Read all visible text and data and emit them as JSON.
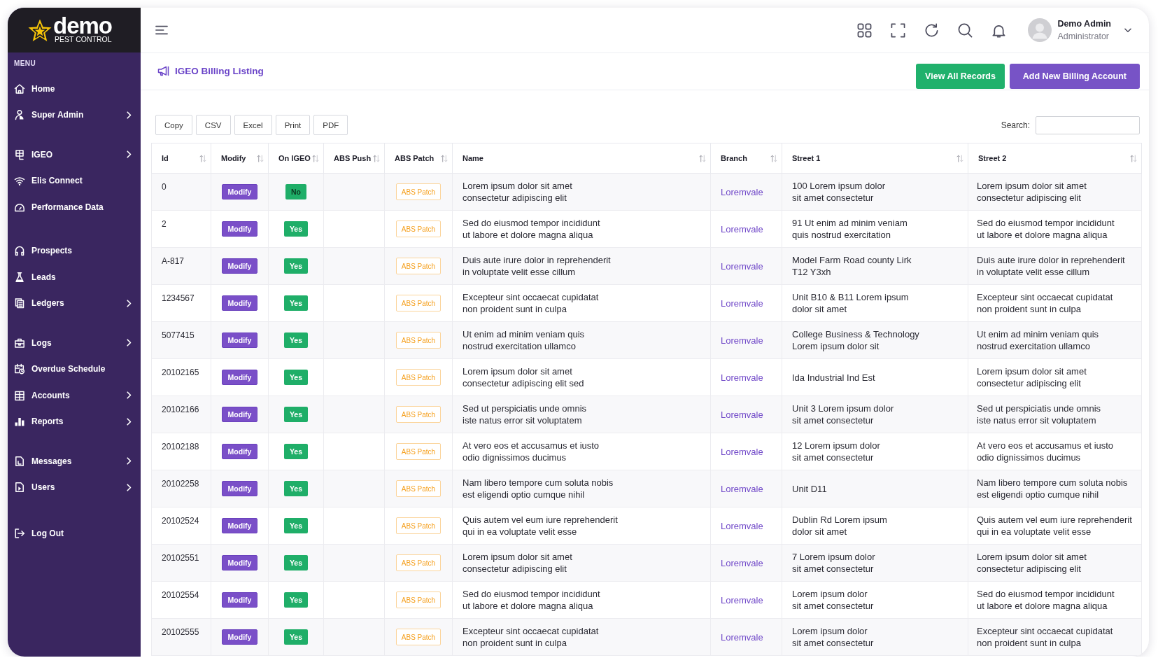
{
  "brand": {
    "name": "demo",
    "tagline": "PEST CONTROL"
  },
  "sidebar": {
    "heading": "MENU",
    "groups": [
      {
        "items": [
          {
            "label": "Home",
            "expandable": false
          },
          {
            "label": "Super Admin",
            "expandable": true
          }
        ]
      },
      {
        "items": [
          {
            "label": "IGEO",
            "expandable": true
          },
          {
            "label": "Elis Connect",
            "expandable": false
          },
          {
            "label": "Performance Data",
            "expandable": false
          }
        ]
      },
      {
        "items": [
          {
            "label": "Prospects",
            "expandable": false
          },
          {
            "label": "Leads",
            "expandable": false
          },
          {
            "label": "Ledgers",
            "expandable": true
          }
        ]
      },
      {
        "items": [
          {
            "label": "Logs",
            "expandable": true
          },
          {
            "label": "Overdue Schedule",
            "expandable": false
          },
          {
            "label": "Accounts",
            "expandable": true
          },
          {
            "label": "Reports",
            "expandable": true
          }
        ]
      },
      {
        "items": [
          {
            "label": "Messages",
            "expandable": true
          },
          {
            "label": "Users",
            "expandable": true
          }
        ]
      },
      {
        "items": [
          {
            "label": "Log Out",
            "expandable": false
          }
        ]
      }
    ]
  },
  "header": {
    "user": {
      "name": "Demo Admin",
      "role": "Administrator"
    }
  },
  "page": {
    "title": "IGEO Billing Listing",
    "actions": [
      {
        "label": "View All Records",
        "kind": "success"
      },
      {
        "label": "Add New Billing Account",
        "kind": "primary"
      }
    ]
  },
  "export_buttons": [
    "Copy",
    "CSV",
    "Excel",
    "Print",
    "PDF"
  ],
  "search": {
    "label": "Search:"
  },
  "table": {
    "columns": [
      "Id",
      "Modify",
      "On IGEO",
      "ABS Push",
      "ABS Patch",
      "Name",
      "Branch",
      "Street 1",
      "Street 2"
    ],
    "rows": [
      {
        "id": "0",
        "modify": "Modify",
        "on_igeo": {
          "label": "No",
          "muted": true
        },
        "abs_patch": "ABS Patch",
        "name": "Lorem ipsum dolor sit amet\nconsectetur adipiscing elit",
        "branch": "Loremvale",
        "street_1": "100 Lorem ipsum dolor\nsit amet consectetur",
        "street_2": "Lorem ipsum dolor sit amet\nconsectetur adipiscing elit"
      },
      {
        "id": "2",
        "modify": "Modify",
        "on_igeo": {
          "label": "Yes",
          "muted": false
        },
        "abs_patch": "ABS Patch",
        "name": "Sed do eiusmod tempor incididunt\nut labore et dolore magna aliqua",
        "branch": "Loremvale",
        "street_1": "91 Ut enim ad minim veniam\nquis nostrud exercitation",
        "street_2": "Sed do eiusmod tempor incididunt\nut labore et dolore magna aliqua"
      },
      {
        "id": "A-817",
        "modify": "Modify",
        "on_igeo": {
          "label": "Yes",
          "muted": false
        },
        "abs_patch": "ABS Patch",
        "name": "Duis aute irure dolor in reprehenderit\nin voluptate velit esse cillum",
        "branch": "Loremvale",
        "street_1": "Model Farm Road county Lirk\nT12 Y3xh",
        "street_2": "Duis aute irure dolor in reprehenderit\nin voluptate velit esse cillum"
      },
      {
        "id": "1234567",
        "modify": "Modify",
        "on_igeo": {
          "label": "Yes",
          "muted": false
        },
        "abs_patch": "ABS Patch",
        "name": "Excepteur sint occaecat cupidatat\nnon proident sunt in culpa",
        "branch": "Loremvale",
        "street_1": "Unit B10 & B11 Lorem ipsum\ndolor sit amet",
        "street_2": "Excepteur sint occaecat cupidatat\nnon proident sunt in culpa"
      },
      {
        "id": "5077415",
        "modify": "Modify",
        "on_igeo": {
          "label": "Yes",
          "muted": false
        },
        "abs_patch": "ABS Patch",
        "name": "Ut enim ad minim veniam quis\nnostrud exercitation ullamco",
        "branch": "Loremvale",
        "street_1": "College Business & Technology\nLorem ipsum dolor sit",
        "street_2": "Ut enim ad minim veniam quis\nnostrud exercitation ullamco"
      },
      {
        "id": "20102165",
        "modify": "Modify",
        "on_igeo": {
          "label": "Yes",
          "muted": false
        },
        "abs_patch": "ABS Patch",
        "name": "Lorem ipsum dolor sit amet\nconsectetur adipiscing elit sed",
        "branch": "Loremvale",
        "street_1": "Ida Industrial Ind Est",
        "street_2": "Lorem ipsum dolor sit amet\nconsectetur adipiscing elit"
      },
      {
        "id": "20102166",
        "modify": "Modify",
        "on_igeo": {
          "label": "Yes",
          "muted": false
        },
        "abs_patch": "ABS Patch",
        "name": "Sed ut perspiciatis unde omnis\niste natus error sit voluptatem",
        "branch": "Loremvale",
        "street_1": "Unit 3 Lorem ipsum dolor\nsit amet consectetur",
        "street_2": "Sed ut perspiciatis unde omnis\niste natus error sit voluptatem"
      },
      {
        "id": "20102188",
        "modify": "Modify",
        "on_igeo": {
          "label": "Yes",
          "muted": false
        },
        "abs_patch": "ABS Patch",
        "name": "At vero eos et accusamus et iusto\nodio dignissimos ducimus",
        "branch": "Loremvale",
        "street_1": "12 Lorem ipsum dolor\nsit amet consectetur",
        "street_2": "At vero eos et accusamus et iusto\nodio dignissimos ducimus"
      },
      {
        "id": "20102258",
        "modify": "Modify",
        "on_igeo": {
          "label": "Yes",
          "muted": false
        },
        "abs_patch": "ABS Patch",
        "name": "Nam libero tempore cum soluta nobis\nest eligendi optio cumque nihil",
        "branch": "Loremvale",
        "street_1": "Unit D11",
        "street_2": "Nam libero tempore cum soluta nobis\nest eligendi optio cumque nihil"
      },
      {
        "id": "20102524",
        "modify": "Modify",
        "on_igeo": {
          "label": "Yes",
          "muted": false
        },
        "abs_patch": "ABS Patch",
        "name": "Quis autem vel eum iure reprehenderit\nqui in ea voluptate velit esse",
        "branch": "Loremvale",
        "street_1": "Dublin Rd Lorem ipsum\ndolor sit amet",
        "street_2": "Quis autem vel eum iure reprehenderit\nqui in ea voluptate velit esse"
      },
      {
        "id": "20102551",
        "modify": "Modify",
        "on_igeo": {
          "label": "Yes",
          "muted": false
        },
        "abs_patch": "ABS Patch",
        "name": "Lorem ipsum dolor sit amet\nconsectetur adipiscing elit",
        "branch": "Loremvale",
        "street_1": "7 Lorem ipsum dolor\nsit amet consectetur",
        "street_2": "Lorem ipsum dolor sit amet\nconsectetur adipiscing elit"
      },
      {
        "id": "20102554",
        "modify": "Modify",
        "on_igeo": {
          "label": "Yes",
          "muted": false
        },
        "abs_patch": "ABS Patch",
        "name": "Sed do eiusmod tempor incididunt\nut labore et dolore magna aliqua",
        "branch": "Loremvale",
        "street_1": "Lorem ipsum dolor\nsit amet consectetur",
        "street_2": "Sed do eiusmod tempor incididunt\nut labore et dolore magna aliqua"
      },
      {
        "id": "20102555",
        "modify": "Modify",
        "on_igeo": {
          "label": "Yes",
          "muted": false
        },
        "abs_patch": "ABS Patch",
        "name": "Excepteur sint occaecat cupidatat\nnon proident sunt in culpa",
        "branch": "Loremvale",
        "street_1": "Lorem ipsum dolor\nsit amet consectetur",
        "street_2": "Excepteur sint occaecat cupidatat\nnon proident sunt in culpa"
      }
    ]
  }
}
